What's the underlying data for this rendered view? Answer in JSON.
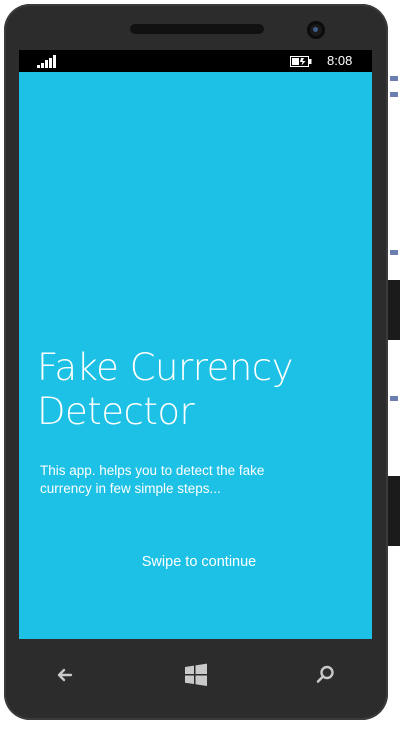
{
  "statusbar": {
    "time": "8:08",
    "signal_icon": "signal-bars-icon",
    "battery_icon": "battery-charging-icon"
  },
  "screen": {
    "background_color": "#1cc1e5",
    "title_line1": "Fake Currency",
    "title_line2": "Detector",
    "description_line1": "This app. helps you to detect the fake",
    "description_line2": "currency in few simple steps...",
    "swipe_hint": "Swipe to continue"
  },
  "navbar": {
    "back_icon": "back-arrow-icon",
    "start_icon": "windows-start-icon",
    "search_icon": "search-icon"
  }
}
